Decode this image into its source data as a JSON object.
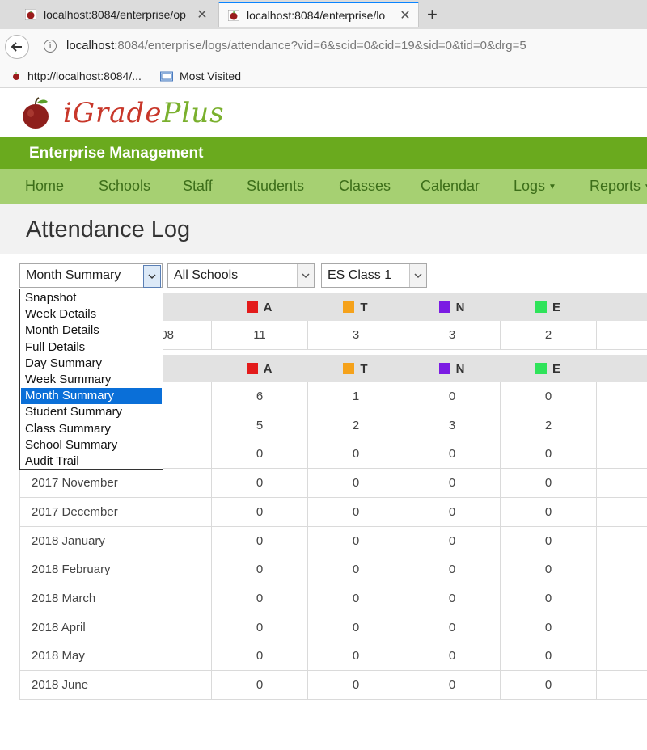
{
  "browser": {
    "tabs": [
      {
        "title": "localhost:8084/enterprise/op",
        "active": false
      },
      {
        "title": "localhost:8084/enterprise/lo",
        "active": true
      }
    ],
    "new_tab_label": "+",
    "url_host": "localhost",
    "url_rest": ":8084/enterprise/logs/attendance?vid=6&scid=0&cid=19&sid=0&tid=0&drg=5",
    "bookmarks": [
      "http://localhost:8084/...",
      "Most Visited"
    ]
  },
  "app": {
    "logo_part1": "iGrade",
    "logo_part2": "Plus",
    "banner": "Enterprise Management",
    "menu": [
      "Home",
      "Schools",
      "Staff",
      "Students",
      "Classes",
      "Calendar",
      "Logs",
      "Reports"
    ],
    "page_title": "Attendance Log"
  },
  "filters": {
    "view": "Month Summary",
    "school": "All Schools",
    "class": "ES Class 1"
  },
  "dropdown": {
    "options": [
      "Snapshot",
      "Week Details",
      "Month Details",
      "Full Details",
      "Day Summary",
      "Week Summary",
      "Month Summary",
      "Student Summary",
      "Class Summary",
      "School Summary",
      "Audit Trail"
    ],
    "selected": "Month Summary"
  },
  "legend": [
    {
      "code": "A",
      "color": "#e31b1b"
    },
    {
      "code": "T",
      "color": "#f5a21b"
    },
    {
      "code": "N",
      "color": "#7b1be3"
    },
    {
      "code": "E",
      "color": "#2fe35a"
    }
  ],
  "totals_row": {
    "label_fragment": "08",
    "values": [
      "11",
      "3",
      "3",
      "2"
    ]
  },
  "monthly_rows": [
    {
      "month": "",
      "values": [
        "6",
        "1",
        "0",
        "0"
      ]
    },
    {
      "month": "",
      "values": [
        "5",
        "2",
        "3",
        "2"
      ]
    },
    {
      "month": "",
      "values": [
        "0",
        "0",
        "0",
        "0"
      ]
    },
    {
      "month": "2017 November",
      "values": [
        "0",
        "0",
        "0",
        "0"
      ]
    },
    {
      "month": "2017 December",
      "values": [
        "0",
        "0",
        "0",
        "0"
      ]
    },
    {
      "month": "2018 January",
      "values": [
        "0",
        "0",
        "0",
        "0"
      ]
    },
    {
      "month": "2018 February",
      "values": [
        "0",
        "0",
        "0",
        "0"
      ]
    },
    {
      "month": "2018 March",
      "values": [
        "0",
        "0",
        "0",
        "0"
      ]
    },
    {
      "month": "2018 April",
      "values": [
        "0",
        "0",
        "0",
        "0"
      ]
    },
    {
      "month": "2018 May",
      "values": [
        "0",
        "0",
        "0",
        "0"
      ]
    },
    {
      "month": "2018 June",
      "values": [
        "0",
        "0",
        "0",
        "0"
      ]
    }
  ]
}
